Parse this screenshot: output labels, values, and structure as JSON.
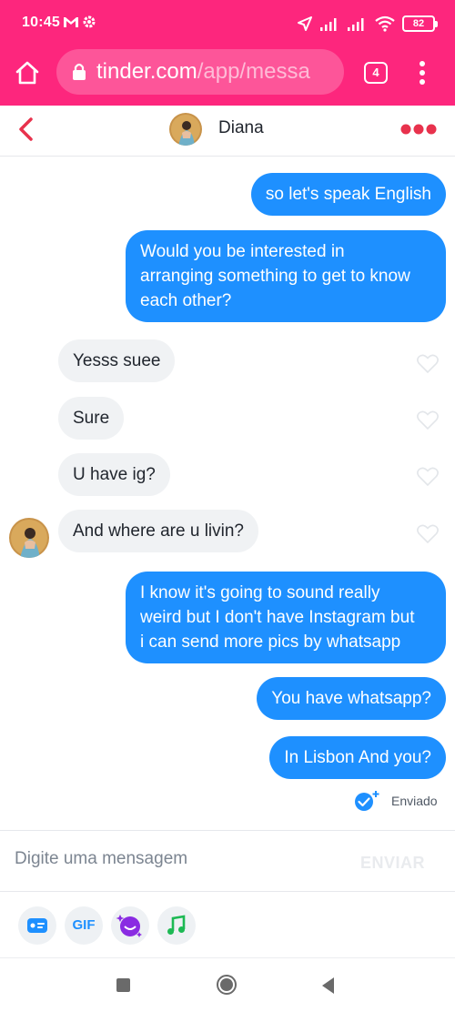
{
  "status_bar": {
    "time": "10:45",
    "battery": "82",
    "icons": [
      "gmail-icon",
      "settings-icon",
      "location-icon",
      "signal-icon",
      "signal-icon",
      "wifi-icon",
      "battery-icon"
    ]
  },
  "browser": {
    "url_host": "tinder.com",
    "url_path": "/app/messa",
    "tab_count": "4"
  },
  "chat": {
    "contact_name": "Diana",
    "messages": [
      {
        "from": "me",
        "text": "so let's speak English"
      },
      {
        "from": "me",
        "lines": [
          "Would you be interested in",
          "arranging something to get to know",
          "each other?"
        ]
      },
      {
        "from": "them",
        "text": "Yesss suee"
      },
      {
        "from": "them",
        "text": "Sure"
      },
      {
        "from": "them",
        "text": "U have ig?"
      },
      {
        "from": "them",
        "text": "And where are u livin?"
      },
      {
        "from": "me",
        "lines": [
          "I know it's going to sound really",
          "weird but I don't have Instagram but",
          "i can send more pics by whatsapp"
        ]
      },
      {
        "from": "me",
        "text": "You have whatsapp?"
      },
      {
        "from": "me",
        "text": "In Lisbon And you?"
      }
    ],
    "sent_status": "Enviado"
  },
  "composer": {
    "placeholder": "Digite uma mensagem",
    "send_label": "ENVIAR",
    "gif_label": "GIF"
  },
  "colors": {
    "brand_pink": "#fd267d",
    "outgoing_bubble": "#1e90ff",
    "incoming_bubble": "#f0f2f4",
    "back_red": "#e8324d"
  }
}
